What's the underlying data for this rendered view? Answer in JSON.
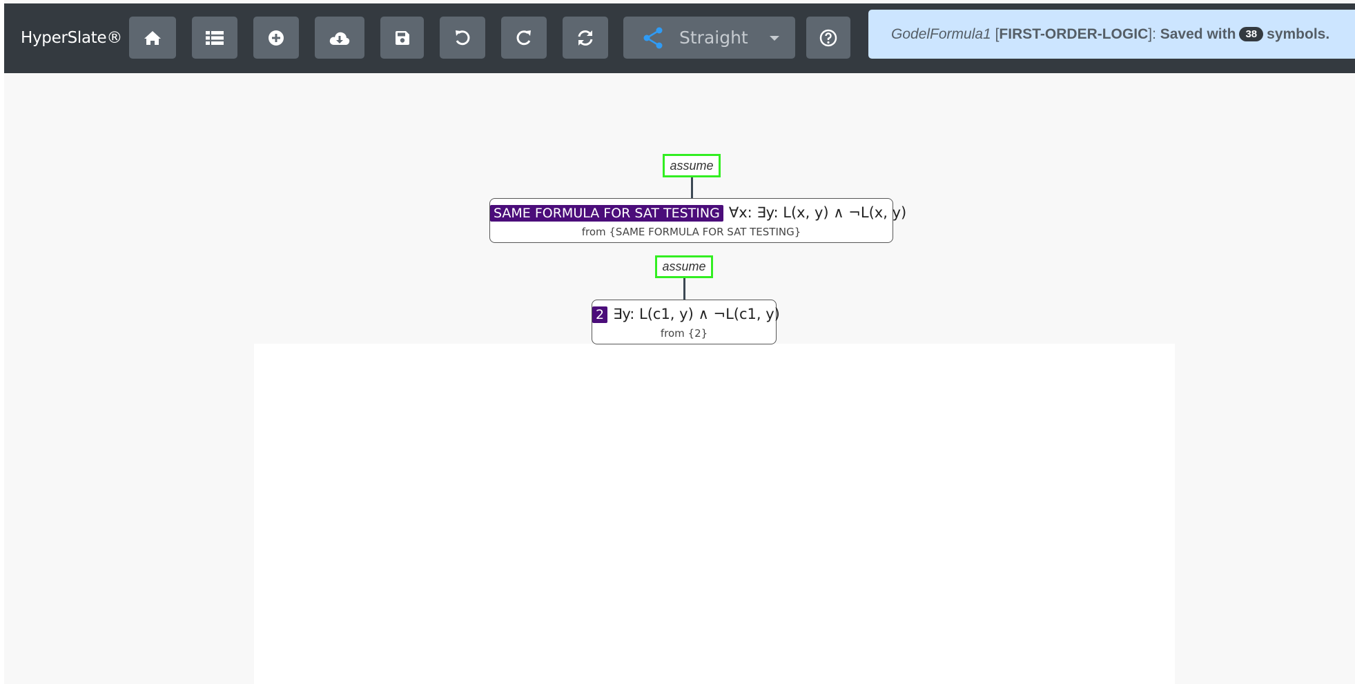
{
  "navbar": {
    "brand": "HyperSlate®",
    "buttons": [
      {
        "name": "home-button",
        "icon": "home-icon"
      },
      {
        "name": "list-button",
        "icon": "list-icon"
      },
      {
        "name": "add-button",
        "icon": "plus-circle-icon"
      },
      {
        "name": "download-button",
        "icon": "cloud-download-icon"
      },
      {
        "name": "save-button",
        "icon": "floppy-disk-icon"
      },
      {
        "name": "undo-button",
        "icon": "undo-icon"
      },
      {
        "name": "redo-button",
        "icon": "redo-icon"
      },
      {
        "name": "refresh-button",
        "icon": "sync-icon"
      },
      {
        "name": "help-button",
        "icon": "question-circle-icon"
      }
    ],
    "edge_style": {
      "icon": "share-icon",
      "selected": "Straight"
    }
  },
  "status": {
    "filename": "GodelFormula1",
    "logic": "FIRST-ORDER-LOGIC",
    "saved_prefix": "Saved with",
    "symbol_count": "38",
    "saved_suffix": "symbols."
  },
  "proof": {
    "nodes": [
      {
        "justification": "assume",
        "label": "SAME FORMULA FOR SAT TESTING",
        "formula": "∀x: ∃y: L(x, y) ∧ ¬L(x, y)",
        "from": "from {SAME FORMULA FOR SAT TESTING}"
      },
      {
        "justification": "assume",
        "label": "2",
        "formula": "∃y: L(c1, y) ∧ ¬L(c1, y)",
        "from": "from {2}"
      }
    ]
  },
  "colors": {
    "navbar": "#343a40",
    "button": "#5e6770",
    "status_bg": "#cce5ff",
    "label_badge": "#4b0d7a",
    "assume_border": "#33ee22",
    "share_icon": "#2f9bf5"
  }
}
